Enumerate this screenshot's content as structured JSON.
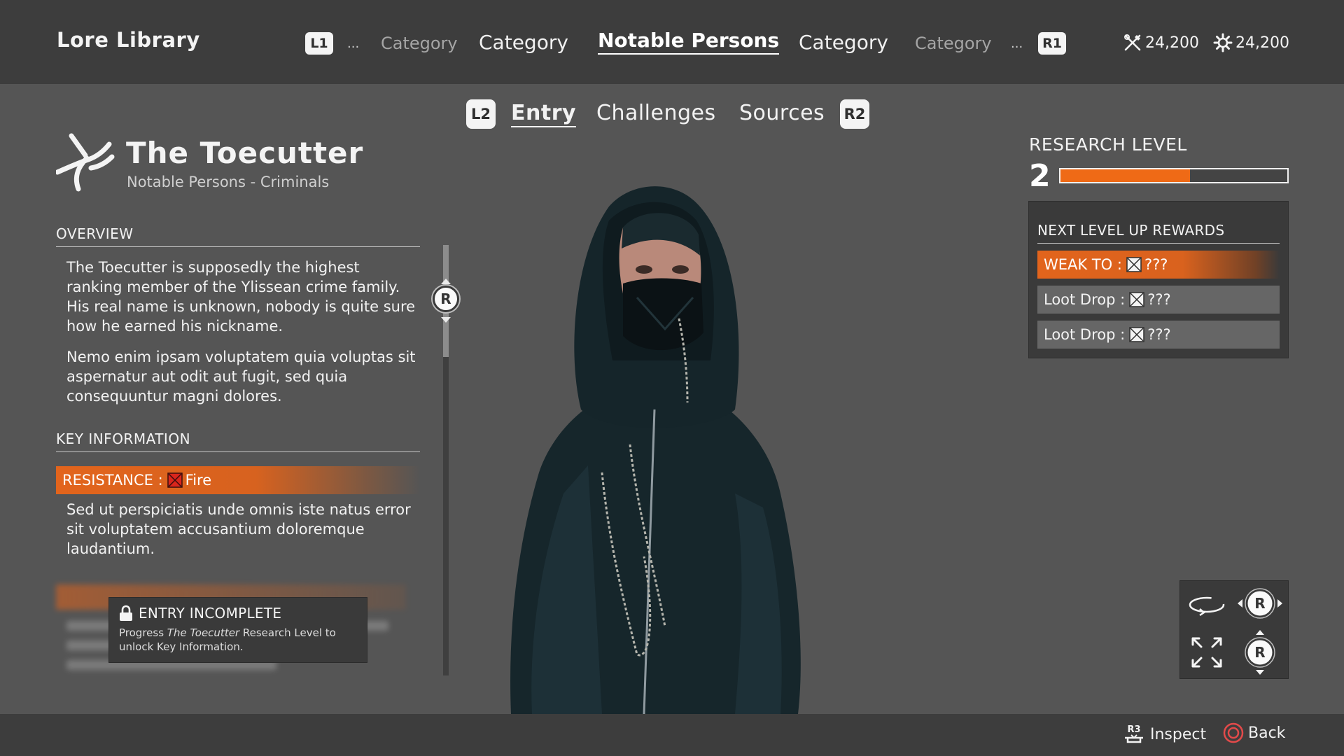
{
  "header": {
    "title": "Lore Library",
    "left_shoulder": "L1",
    "right_shoulder": "R1",
    "ellipsis": "...",
    "categories": [
      {
        "label": "Category",
        "state": "dim"
      },
      {
        "label": "Category",
        "state": "normal"
      },
      {
        "label": "Notable Persons",
        "state": "active"
      },
      {
        "label": "Category",
        "state": "normal"
      },
      {
        "label": "Category",
        "state": "dim"
      }
    ],
    "currencies": [
      {
        "icon": "tool-icon",
        "value": "24,200"
      },
      {
        "icon": "gear-icon",
        "value": "24,200"
      }
    ]
  },
  "subtabs": {
    "left_trigger": "L2",
    "right_trigger": "R2",
    "items": [
      {
        "label": "Entry",
        "active": true
      },
      {
        "label": "Challenges",
        "active": false
      },
      {
        "label": "Sources",
        "active": false
      }
    ]
  },
  "entry": {
    "name": "The Toecutter",
    "subtitle": "Notable Persons - Criminals",
    "overview_title": "OVERVIEW",
    "overview_paragraphs": [
      "The Toecutter is supposedly the highest ranking member of the Ylissean crime family. His real name is unknown, nobody is quite sure how he earned his nickname.",
      "Nemo enim ipsam voluptatem quia voluptas sit aspernatur aut odit aut fugit, sed quia consequuntur magni dolores."
    ],
    "key_info_title": "KEY INFORMATION",
    "resistance_label": "RESISTANCE :",
    "resistance_value": "Fire",
    "key_info_text": "Sed ut perspiciatis unde omnis iste natus error sit voluptatem accusantium doloremque laudantium.",
    "locked": {
      "title": "ENTRY INCOMPLETE",
      "text_pre": "Progress ",
      "text_name": "The Toecutter",
      "text_post": " Research Level to unlock Key Information."
    },
    "scroll_button": "R"
  },
  "research": {
    "title": "RESEARCH LEVEL",
    "level": "2",
    "progress": 0.57,
    "accent": "#ef6a16",
    "rewards_title": "NEXT LEVEL UP REWARDS",
    "rewards": [
      {
        "label": "WEAK TO :",
        "value": "???",
        "highlight": true
      },
      {
        "label": "Loot Drop :",
        "value": "???",
        "highlight": false
      },
      {
        "label": "Loot Drop :",
        "value": "???",
        "highlight": false
      }
    ]
  },
  "controls": {
    "stick_label": "R",
    "rotate_icon": "rotate-icon",
    "zoom_icon": "expand-icon"
  },
  "footer": {
    "inspect_button": "R3",
    "inspect_label": "Inspect",
    "back_label": "Back",
    "back_color": "#e24a4a"
  }
}
